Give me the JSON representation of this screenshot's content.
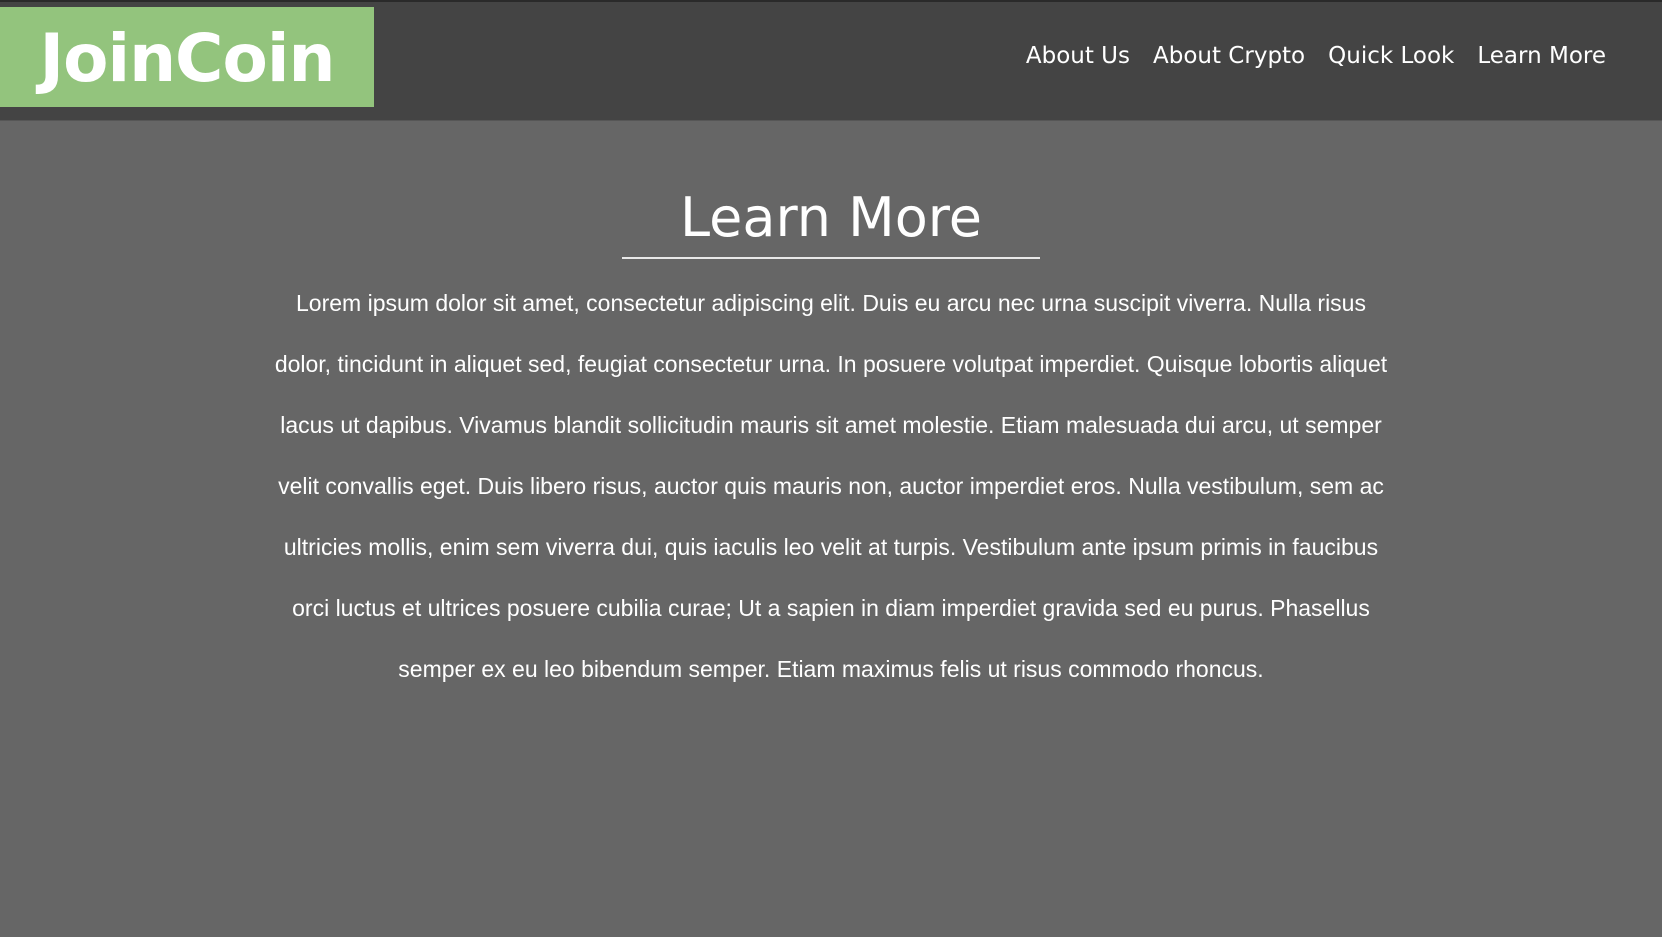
{
  "header": {
    "logo_text": "JoinCoin",
    "nav": [
      {
        "label": "About Us"
      },
      {
        "label": "About Crypto"
      },
      {
        "label": "Quick Look"
      },
      {
        "label": "Learn More"
      }
    ]
  },
  "main": {
    "title": "Learn More",
    "body": "Lorem ipsum dolor sit amet, consectetur adipiscing elit. Duis eu arcu nec urna suscipit viverra. Nulla risus dolor, tincidunt in aliquet sed, feugiat consectetur urna. In posuere volutpat imperdiet. Quisque lobortis aliquet lacus ut dapibus. Vivamus blandit sollicitudin mauris sit amet molestie. Etiam malesuada dui arcu, ut semper velit convallis eget. Duis libero risus, auctor quis mauris non, auctor imperdiet eros. Nulla vestibulum, sem ac ultricies mollis, enim sem viverra dui, quis iaculis leo velit at turpis. Vestibulum ante ipsum primis in faucibus orci luctus et ultrices posuere cubilia curae; Ut a sapien in diam imperdiet gravida sed eu purus. Phasellus semper ex eu leo bibendum semper. Etiam maximus felis ut risus commodo rhoncus."
  },
  "colors": {
    "header_bg": "#444444",
    "page_bg": "#666666",
    "logo_bg": "#93c47d",
    "text": "#ffffff"
  }
}
